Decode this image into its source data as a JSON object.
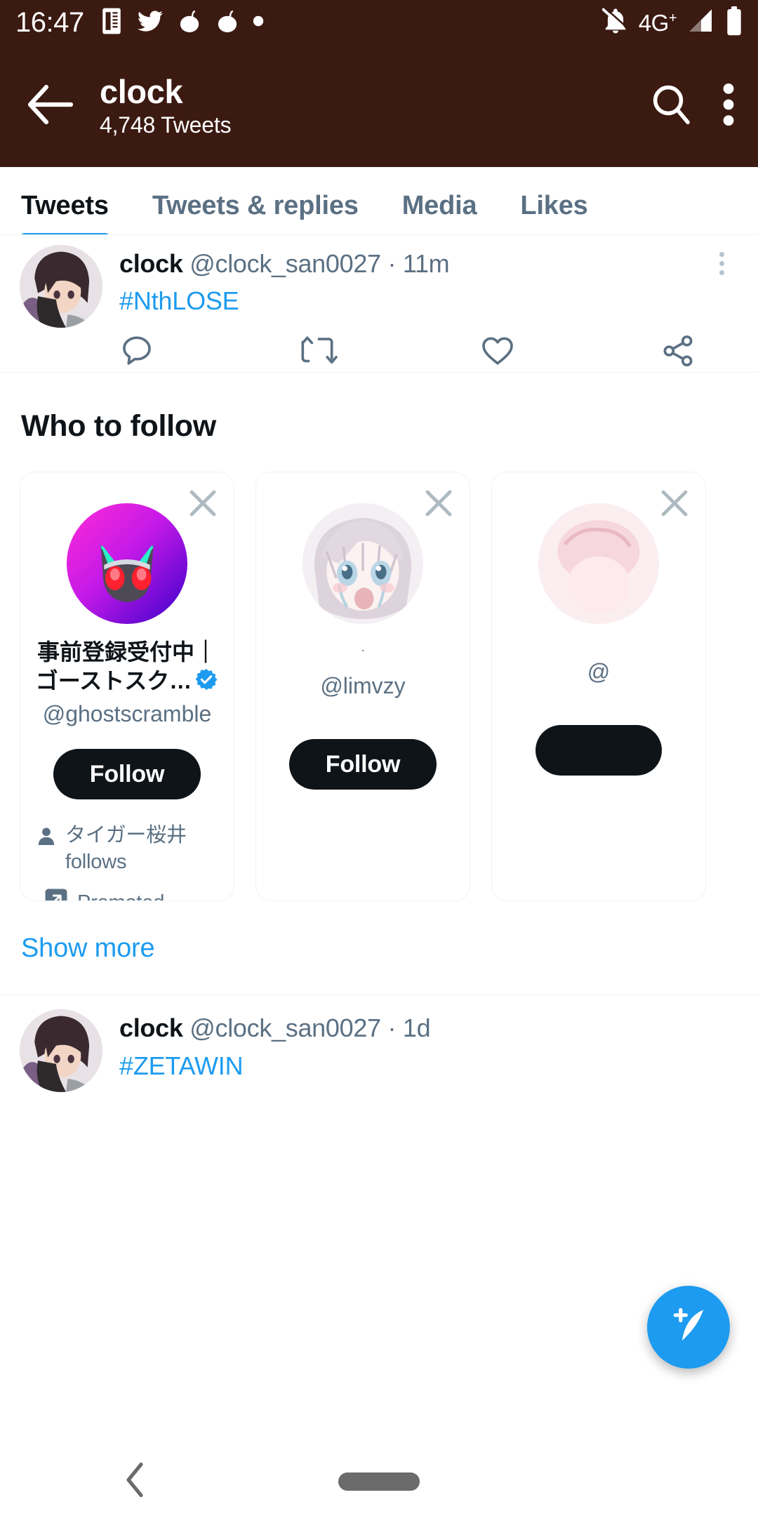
{
  "status_bar": {
    "time": "16:47",
    "left_icons": [
      "calendar-icon",
      "twitter-bird-icon",
      "reddit-icon",
      "reddit-icon",
      "dot-icon"
    ],
    "network_label": "4G",
    "network_superscript": "+",
    "right_icons": [
      "notifications-off-icon",
      "signal-icon",
      "battery-icon"
    ]
  },
  "app_bar": {
    "back_icon": "arrow-left-icon",
    "title": "clock",
    "subtitle": "4,748 Tweets",
    "search_icon": "search-icon",
    "overflow_icon": "more-vertical-icon"
  },
  "tabs": [
    {
      "label": "Tweets",
      "active": true
    },
    {
      "label": "Tweets & replies",
      "active": false
    },
    {
      "label": "Media",
      "active": false
    },
    {
      "label": "Likes",
      "active": false
    }
  ],
  "tweets": [
    {
      "name": "clock",
      "handle": "@clock_san0027",
      "separator": "·",
      "time": "11m",
      "text": "#NthLOSE",
      "actions": [
        "reply-icon",
        "retweet-icon",
        "like-icon",
        "share-icon"
      ]
    },
    {
      "name": "clock",
      "handle": "@clock_san0027",
      "separator": "·",
      "time": "1d",
      "text": "#ZETAWIN"
    }
  ],
  "who_to_follow": {
    "title": "Who to follow",
    "show_more_label": "Show more",
    "cards": [
      {
        "name": "事前登録受付中｜",
        "name_line2": "ゴーストスク…",
        "verified": true,
        "handle": "@ghostscramble",
        "follow_label": "Follow",
        "social_proof_name": "タイガー桜井",
        "social_proof_suffix": "follows",
        "promoted_label": "Promoted",
        "close_icon": "close-icon",
        "avatar_kind": "ghost-cat-avatar"
      },
      {
        "name": ".",
        "verified": false,
        "handle": "@limvzy",
        "follow_label": "Follow",
        "close_icon": "close-icon",
        "avatar_kind": "anime-girl-avatar"
      },
      {
        "name": "",
        "verified": false,
        "handle": "@",
        "follow_label": "",
        "close_icon": "close-icon",
        "avatar_kind": "pink-avatar"
      }
    ]
  },
  "compose_button": {
    "icon": "compose-feather-icon"
  },
  "nav_bar": {
    "back_icon": "chevron-left-icon",
    "home_pill": "home-pill"
  },
  "colors": {
    "header_bg": "#3b1a12",
    "accent_blue": "#1d9bf0",
    "text_primary": "#0f1419",
    "text_secondary": "#5b7083",
    "follow_button_bg": "#0f1419",
    "divider": "#eff3f4"
  }
}
